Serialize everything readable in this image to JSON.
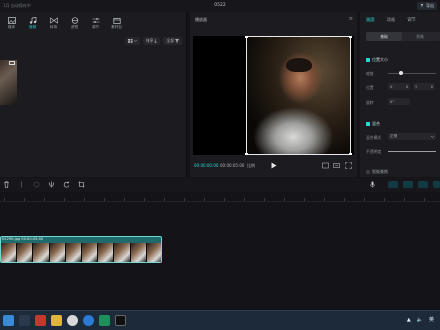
{
  "window": {
    "left_title": "1月 自动保存中",
    "project_title": "0522",
    "export_label": "导出"
  },
  "toolbar": {
    "items": [
      {
        "label": "媒体",
        "icon": "media-icon",
        "active": false
      },
      {
        "label": "音频",
        "icon": "audio-icon",
        "active": true
      },
      {
        "label": "转场",
        "icon": "transition-icon",
        "active": false
      },
      {
        "label": "滤镜",
        "icon": "filter-icon",
        "active": false
      },
      {
        "label": "调节",
        "icon": "adjust-icon",
        "active": false
      },
      {
        "label": "素材包",
        "icon": "package-icon",
        "active": false
      }
    ]
  },
  "media": {
    "sort_label": "排序",
    "all_label": "全部"
  },
  "player": {
    "title": "播放器",
    "timecode_current": "00:00:00:00",
    "timecode_total": "00:00:05:00",
    "ratio_label": "比例"
  },
  "props": {
    "tabs": [
      {
        "label": "画面",
        "active": true
      },
      {
        "label": "动画",
        "active": false
      },
      {
        "label": "调节",
        "active": false
      }
    ],
    "subtabs": [
      {
        "label": "基础",
        "active": true
      },
      {
        "label": "抠像",
        "active": false
      }
    ],
    "position_size": "位置大小",
    "scale_label": "缩放",
    "position_label": "位置",
    "position_x": "0",
    "position_y": "0",
    "rotation_label": "旋转",
    "rotation_value": "0°",
    "blend_section": "混合",
    "blend_mode_label": "混合模式",
    "blend_mode_value": "正常",
    "opacity_label": "不透明度",
    "stabilize_label": "智能美颜"
  },
  "timeline": {
    "clip_label": "05290.jpg  00:00:05:00",
    "frame_count": 10
  },
  "taskbar": {
    "time_text": "英",
    "ime": "中"
  },
  "colors": {
    "accent": "#2ad8d4",
    "clip": "#1f6b6b",
    "panel": "#1b1b20",
    "taskbar": "#1d2a3a"
  }
}
